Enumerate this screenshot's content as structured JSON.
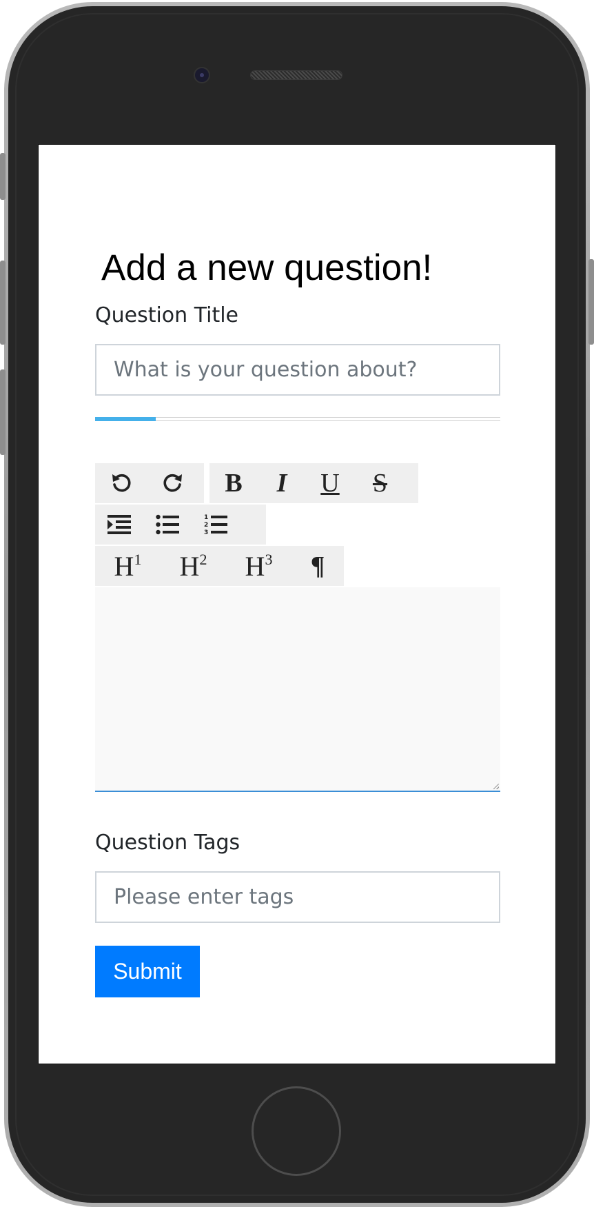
{
  "form": {
    "heading": "Add a new question!",
    "title_label": "Question Title",
    "title_placeholder": "What is your question about?",
    "title_value": "",
    "title_progress": 0.15,
    "tags_label": "Question Tags",
    "tags_placeholder": "Please enter tags",
    "tags_value": "",
    "submit_label": "Submit"
  },
  "editor": {
    "toolbar": {
      "history": [
        "undo-icon",
        "redo-icon"
      ],
      "formatting": [
        {
          "name": "bold",
          "glyph": "B"
        },
        {
          "name": "italic",
          "glyph": "I"
        },
        {
          "name": "underline",
          "glyph": "U"
        },
        {
          "name": "strikethrough",
          "glyph": "S"
        }
      ],
      "lists": [
        "indent-icon",
        "bullet-list-icon",
        "numbered-list-icon"
      ],
      "headings": [
        {
          "letter": "H",
          "level": "1"
        },
        {
          "letter": "H",
          "level": "2"
        },
        {
          "letter": "H",
          "level": "3"
        }
      ],
      "paragraph_glyph": "¶"
    },
    "content": ""
  },
  "colors": {
    "primary": "#007bff",
    "progress": "#44b0ea",
    "editor_focus": "#3b8ed6"
  }
}
